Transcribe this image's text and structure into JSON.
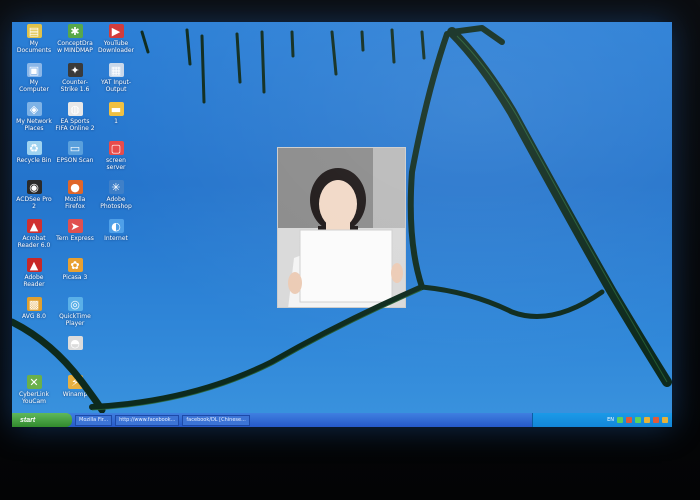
{
  "desktop_icons": [
    {
      "label": "My Documents",
      "icon": "documents-icon",
      "glyph": "▤",
      "color": "#e0c24a"
    },
    {
      "label": "ConceptDraw MINDMAP",
      "icon": "mindmap-icon",
      "glyph": "✱",
      "color": "#58a84a"
    },
    {
      "label": "YouTube Downloader",
      "icon": "youtube-icon",
      "glyph": "▶",
      "color": "#d23b3b"
    },
    {
      "label": "My Computer",
      "icon": "computer-icon",
      "glyph": "▣",
      "color": "#8bb7e8"
    },
    {
      "label": "Counter-Strike 1.6",
      "icon": "counter-strike-icon",
      "glyph": "✦",
      "color": "#3a3a3a"
    },
    {
      "label": "YAT Input-Output",
      "icon": "yat-icon",
      "glyph": "▦",
      "color": "#c9d8ea"
    },
    {
      "label": "My Network Places",
      "icon": "network-icon",
      "glyph": "◈",
      "color": "#7fb3e6"
    },
    {
      "label": "EA Sports FIFA Online 2",
      "icon": "fifa-icon",
      "glyph": "◍",
      "color": "#e8e8e8"
    },
    {
      "label": "1",
      "icon": "folder-icon",
      "glyph": "▬",
      "color": "#f0c040"
    },
    {
      "label": "Recycle Bin",
      "icon": "recycle-bin-icon",
      "glyph": "♻",
      "color": "#9fd3f0"
    },
    {
      "label": "EPSON Scan",
      "icon": "epson-scan-icon",
      "glyph": "▭",
      "color": "#5aa0dc"
    },
    {
      "label": "screen server",
      "icon": "screen-server-icon",
      "glyph": "▢",
      "color": "#e84a4a"
    },
    {
      "label": "ACDSee Pro 2",
      "icon": "acdsee-icon",
      "glyph": "◉",
      "color": "#2a2a2a"
    },
    {
      "label": "Mozilla Firefox",
      "icon": "firefox-icon",
      "glyph": "●",
      "color": "#e0662a"
    },
    {
      "label": "Adobe Photoshop",
      "icon": "photoshop-icon",
      "glyph": "✳",
      "color": "#3e7fc8"
    },
    {
      "label": "Acrobat Reader 6.0",
      "icon": "acrobat-icon",
      "glyph": "▲",
      "color": "#d03030"
    },
    {
      "label": "Tern Express",
      "icon": "tern-express-icon",
      "glyph": "➤",
      "color": "#e05050"
    },
    {
      "label": "Internet",
      "icon": "internet-icon",
      "glyph": "◐",
      "color": "#4fa0e8"
    },
    {
      "label": "Adobe Reader",
      "icon": "adobe-reader-icon",
      "glyph": "▲",
      "color": "#c82828"
    },
    {
      "label": "Picasa 3",
      "icon": "picasa-icon",
      "glyph": "✿",
      "color": "#e8a030"
    },
    {
      "label": "",
      "icon": "blank-icon",
      "glyph": "",
      "color": "transparent"
    },
    {
      "label": "AVG 8.0",
      "icon": "avg-icon",
      "glyph": "▩",
      "color": "#e0a030"
    },
    {
      "label": "QuickTime Player",
      "icon": "quicktime-icon",
      "glyph": "◎",
      "color": "#5ab0e8"
    },
    {
      "label": "",
      "icon": "blank-icon",
      "glyph": "",
      "color": "transparent"
    },
    {
      "label": "",
      "icon": "blank-icon",
      "glyph": "",
      "color": "transparent"
    },
    {
      "label": "",
      "icon": "media-icon",
      "glyph": "◓",
      "color": "#dcdcdc"
    },
    {
      "label": "",
      "icon": "blank-icon",
      "glyph": "",
      "color": "transparent"
    },
    {
      "label": "CyberLink YouCam",
      "icon": "youcam-icon",
      "glyph": "✕",
      "color": "#6ab04a"
    },
    {
      "label": "Winamp",
      "icon": "winamp-icon",
      "glyph": "⚡",
      "color": "#e8b040"
    }
  ],
  "taskbar": {
    "start_label": "start",
    "tasks": [
      "Mozilla Fir...",
      "http://www.facebook...",
      "facebook/DL [Chinese..."
    ],
    "tray_label": "EN"
  },
  "bezel_logo": "",
  "colors": {
    "desktop": "#2474cc",
    "taskbar": "#2659c9",
    "start": "#318a2d",
    "tray": "#1286d8"
  }
}
